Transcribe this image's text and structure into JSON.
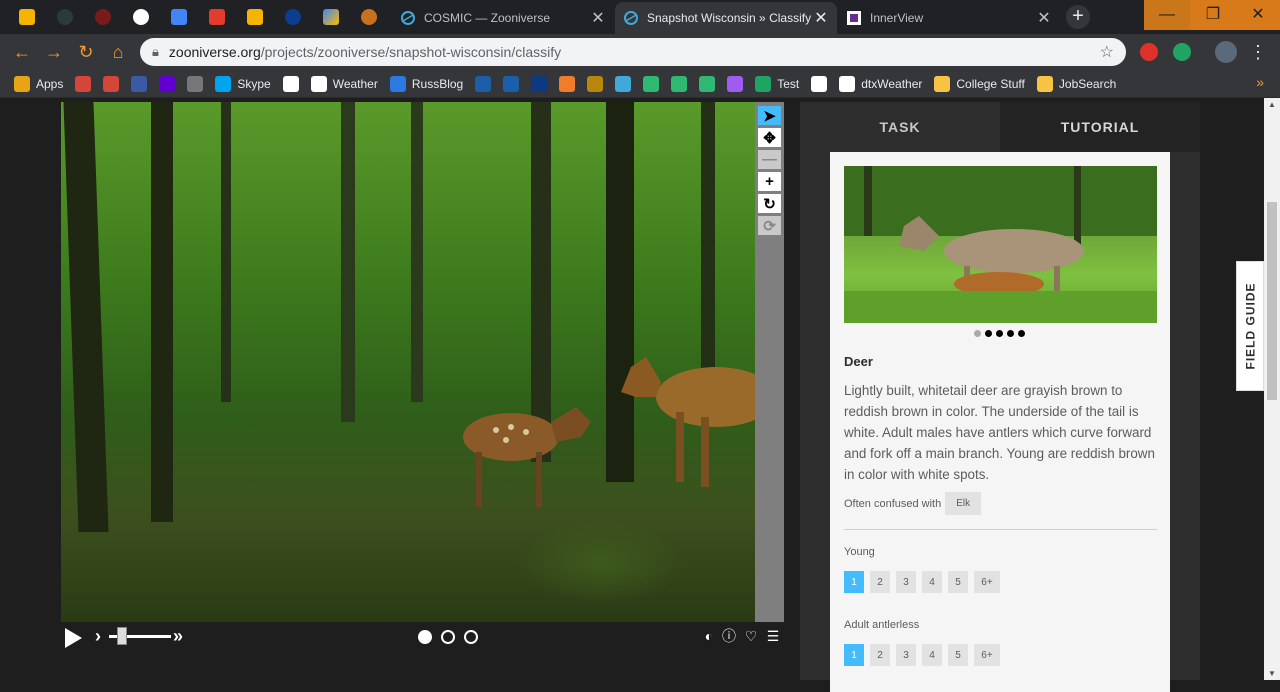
{
  "browser": {
    "tabs": [
      {
        "title": "COSMIC — Zooniverse",
        "active": false
      },
      {
        "title": "Snapshot Wisconsin » Classify",
        "active": true
      },
      {
        "title": "InnerView",
        "active": false
      }
    ],
    "url": {
      "host": "zooniverse.org",
      "path": "/projects/zooniverse/snapshot-wisconsin/classify"
    },
    "bookmarks": [
      {
        "label": "Apps",
        "icon": "apps-grid-icon",
        "color": "#e8a317"
      },
      {
        "label": "",
        "icon": "gmail-icon",
        "color": "#d44638"
      },
      {
        "label": "",
        "icon": "gmail-icon",
        "color": "#d44638"
      },
      {
        "label": "",
        "icon": "hac-icon",
        "color": "#3a5aa8"
      },
      {
        "label": "",
        "icon": "yahoo-icon",
        "color": "#6001d2"
      },
      {
        "label": "",
        "icon": "satellite-icon",
        "color": "#777777"
      },
      {
        "label": "Skype",
        "icon": "windows-icon",
        "color": "#00a4ef"
      },
      {
        "label": "",
        "icon": "kyue-icon",
        "color": "#ffffff"
      },
      {
        "label": "Weather",
        "icon": "kyue-icon",
        "color": "#ffffff"
      },
      {
        "label": "RussBlog",
        "icon": "blog-icon",
        "color": "#2a7ae2"
      },
      {
        "label": "",
        "icon": "noaa-icon",
        "color": "#1a5fa8"
      },
      {
        "label": "",
        "icon": "noaa-icon",
        "color": "#1a5fa8"
      },
      {
        "label": "",
        "icon": "weather-service-icon",
        "color": "#0b3a82"
      },
      {
        "label": "",
        "icon": "sun-icon",
        "color": "#f07d2a"
      },
      {
        "label": "",
        "icon": "star-icon",
        "color": "#b8860b"
      },
      {
        "label": "",
        "icon": "zooniverse-icon",
        "color": "#3fa9d9"
      },
      {
        "label": "",
        "icon": "person-icon",
        "color": "#2eb872"
      },
      {
        "label": "",
        "icon": "person-icon",
        "color": "#2eb872"
      },
      {
        "label": "",
        "icon": "person-icon",
        "color": "#2eb872"
      },
      {
        "label": "",
        "icon": "logi-icon",
        "color": "#a05cf0"
      },
      {
        "label": "Test",
        "icon": "leaf-icon",
        "color": "#1fa463"
      },
      {
        "label": "",
        "icon": "dtx-icon",
        "color": "#ffffff"
      },
      {
        "label": "dtxWeather",
        "icon": "dtx-icon",
        "color": "#ffffff"
      },
      {
        "label": "College Stuff",
        "icon": "folder-icon",
        "color": "#f6c343"
      },
      {
        "label": "JobSearch",
        "icon": "folder-icon",
        "color": "#f6c343"
      }
    ],
    "more": "»"
  },
  "viewer": {
    "tools": [
      {
        "name": "pointer-tool",
        "glyph": "➤",
        "state": "active"
      },
      {
        "name": "pan-tool",
        "glyph": "✥",
        "state": "normal"
      },
      {
        "name": "zoom-out-tool",
        "glyph": "—",
        "state": "disabled"
      },
      {
        "name": "zoom-in-tool",
        "glyph": "+",
        "state": "normal"
      },
      {
        "name": "rotate-tool",
        "glyph": "↻",
        "state": "normal"
      },
      {
        "name": "reset-tool",
        "glyph": "⟳",
        "state": "disabled"
      }
    ],
    "frames": 3,
    "current_frame": 1
  },
  "panel": {
    "tabs": {
      "task": "TASK",
      "tutorial": "TUTORIAL"
    },
    "species": {
      "name": "Deer",
      "description": "Lightly built, whitetail deer are grayish brown to reddish brown in color. The underside of the tail is white. Adult males have antlers which curve forward and fork off a main branch. Young are reddish brown in color with white spots.",
      "confused_label": "Often confused with",
      "confused_with": "Elk"
    },
    "carousel_images": 5,
    "carousel_current": 1,
    "questions": [
      {
        "label": "Young",
        "options": [
          "1",
          "2",
          "3",
          "4",
          "5",
          "6+"
        ],
        "selected": "1"
      },
      {
        "label": "Adult antlerless",
        "options": [
          "1",
          "2",
          "3",
          "4",
          "5",
          "6+"
        ],
        "selected": "1"
      }
    ]
  },
  "field_guide": "FIELD GUIDE",
  "colors": {
    "accent": "#43bbfd",
    "chrome_orange": "#f29b30"
  }
}
